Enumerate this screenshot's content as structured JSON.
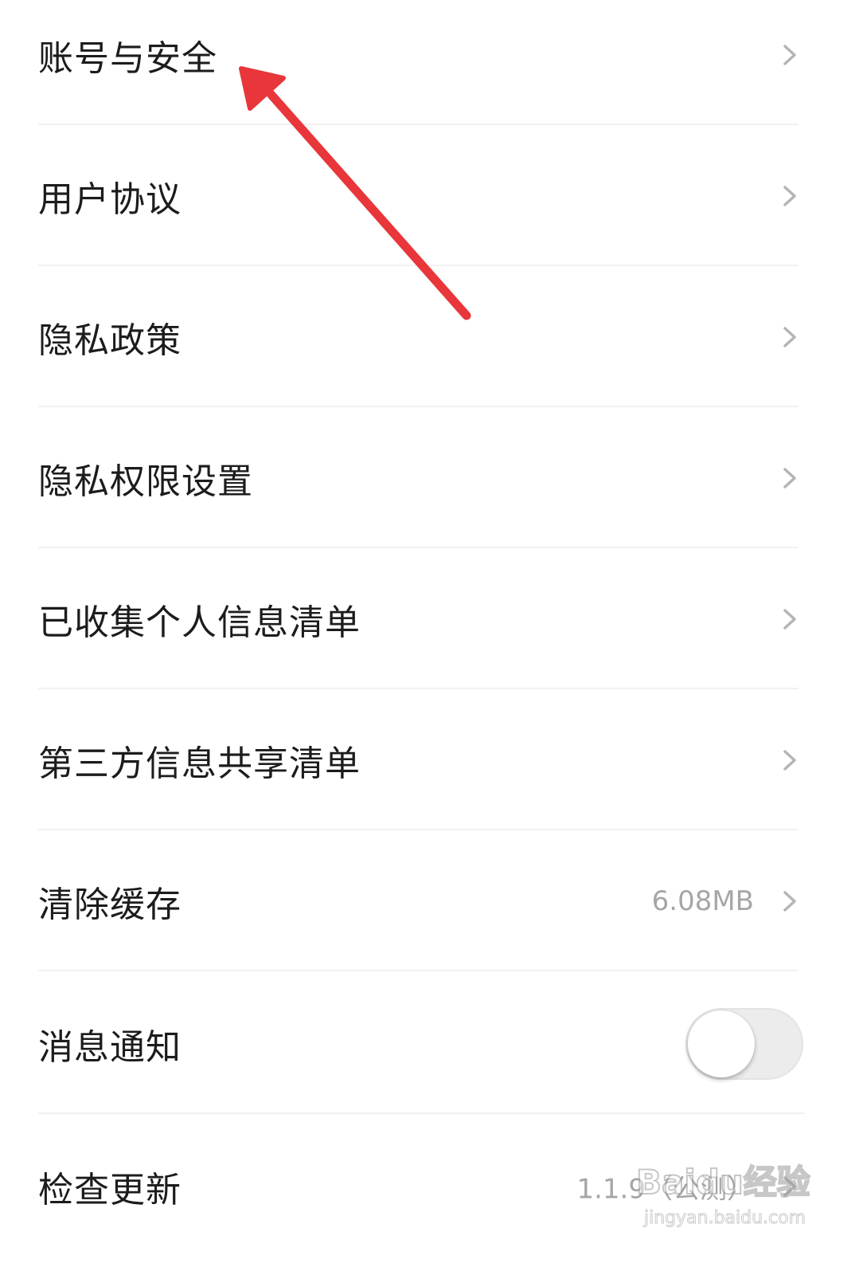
{
  "settings": {
    "items": [
      {
        "label": "账号与安全",
        "value": "",
        "control": "chevron"
      },
      {
        "label": "用户协议",
        "value": "",
        "control": "chevron"
      },
      {
        "label": "隐私政策",
        "value": "",
        "control": "chevron"
      },
      {
        "label": "隐私权限设置",
        "value": "",
        "control": "chevron"
      },
      {
        "label": "已收集个人信息清单",
        "value": "",
        "control": "chevron"
      },
      {
        "label": "第三方信息共享清单",
        "value": "",
        "control": "chevron"
      },
      {
        "label": "清除缓存",
        "value": "6.08MB",
        "control": "chevron"
      },
      {
        "label": "消息通知",
        "value": "",
        "control": "toggle",
        "toggle_on": false
      },
      {
        "label": "检查更新",
        "value": "1.1.9（公测）",
        "control": "chevron"
      }
    ]
  },
  "annotation": {
    "type": "arrow",
    "color": "#e8363a",
    "points_to": "账号与安全"
  },
  "watermark": {
    "brand": "Baidu经验",
    "url": "jingyan.baidu.com"
  },
  "colors": {
    "label": "#1c1c1c",
    "value": "#a6a6a6",
    "chevron": "#b5b5b5",
    "divider": "#f1f1f1",
    "toggle_track": "#ececec",
    "toggle_knob": "#ffffff"
  }
}
